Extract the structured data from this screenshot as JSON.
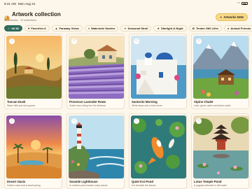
{
  "status": {
    "time": "8:41 AM",
    "date": "Mon Aug 31"
  },
  "header": {
    "title": "Artwork collection",
    "subtitle": "82 artworks · 12 collections",
    "badge_label": "Artworks 6262"
  },
  "chips": [
    {
      "label": "All 82",
      "icon": "check-icon",
      "active": true
    },
    {
      "label": "Favorites 8",
      "icon": "heart-icon"
    },
    {
      "label": "Faraway Views",
      "icon": "mountain-icon"
    },
    {
      "label": "Waterside Garden",
      "icon": "water-icon"
    },
    {
      "label": "Seasonal Stroll",
      "icon": "leaf-icon"
    },
    {
      "label": "Starlight & Night",
      "icon": "star-icon"
    },
    {
      "label": "Tender Still Lifes",
      "icon": "flower-icon"
    },
    {
      "label": "Animal Friends",
      "icon": "paw-icon"
    }
  ],
  "cards": [
    {
      "title": "Tuscan Dusk",
      "subtitle": "Warm hills and tall cypress"
    },
    {
      "title": "Provence Lavender Rows",
      "subtitle": "Violet rows rolling into the distance"
    },
    {
      "title": "Santorini Morning",
      "subtitle": "White steps and a blue dome"
    },
    {
      "title": "Alpine Chalet",
      "subtitle": "Lake, green cabin and timber walls"
    },
    {
      "title": "Desert Oasis",
      "subtitle": "Golden sand and a small spring"
    },
    {
      "title": "Seaside Lighthouse",
      "subtitle": "A northern point beside rocky waves"
    },
    {
      "title": "Quiet Koi Pond",
      "subtitle": "Koi beneath the leaves"
    },
    {
      "title": "Lotus Temple Pond",
      "subtitle": "A pagoda reflected in still water"
    }
  ],
  "colors": {
    "accent": "#2f6b5b",
    "badge": "#f6d98a",
    "background": "#fdf6ea"
  }
}
